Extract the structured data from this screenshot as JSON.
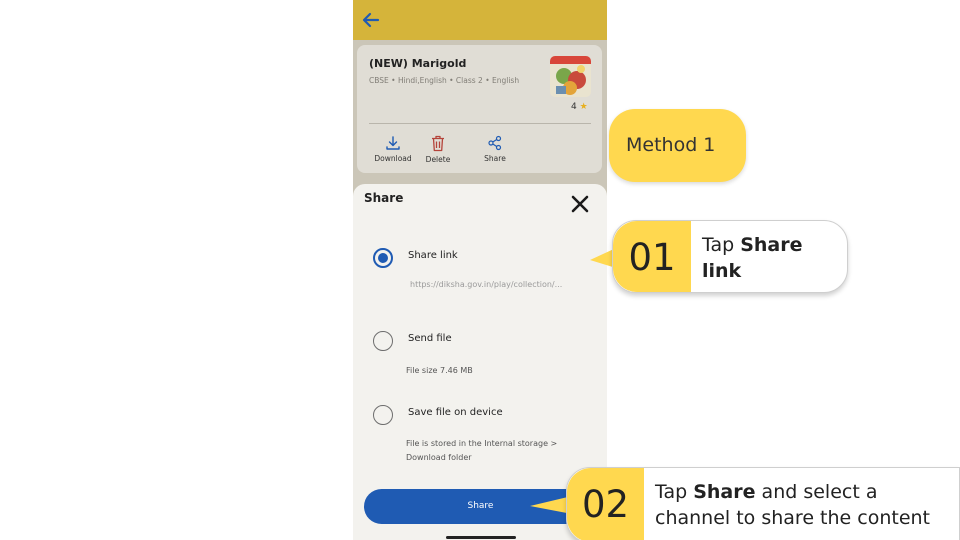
{
  "app": {
    "content": {
      "title": "(NEW) Marigold",
      "meta": "CBSE  •  Hindi,English  •  Class 2  •  English",
      "rating": "4",
      "rating_star": "★",
      "actions": [
        {
          "label": "Download",
          "icon": "download-icon"
        },
        {
          "label": "Delete",
          "icon": "trash-icon"
        },
        {
          "label": "Share",
          "icon": "share-icon"
        }
      ]
    },
    "share_sheet": {
      "title": "Share",
      "options": [
        {
          "label": "Share link",
          "sub": "https://diksha.gov.in/play/collection/...",
          "selected": true
        },
        {
          "label": "Send file",
          "sub": "File size 7.46 MB",
          "selected": false
        },
        {
          "label": "Save file on device",
          "sub_line1": "File is stored in the Internal storage >",
          "sub_line2": "Download folder",
          "selected": false
        }
      ],
      "button_label": "Share"
    },
    "colors": {
      "appbar": "#d5b43a",
      "primary": "#1f5bb3",
      "callout": "#ffd84f",
      "delete": "#b5433a"
    }
  },
  "callouts": {
    "method": "Method 1",
    "step1": {
      "number": "01",
      "text_pre": "Tap ",
      "text_bold": "Share link",
      "text_post": ""
    },
    "step2": {
      "number": "02",
      "text_pre": "Tap ",
      "text_bold": "Share",
      "text_post": " and select a",
      "line2": "channel to share the content"
    }
  }
}
